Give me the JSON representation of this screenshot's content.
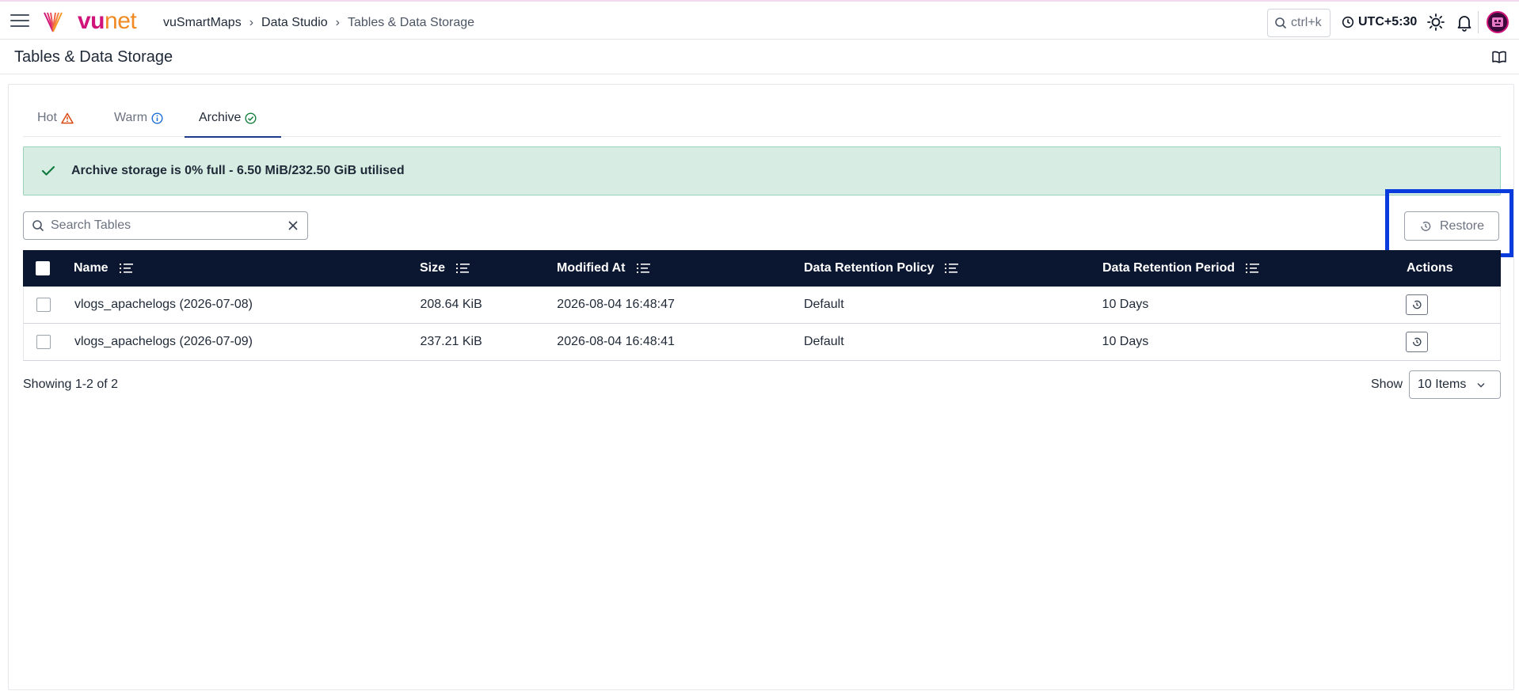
{
  "topbar": {
    "logo_vu": "vu",
    "logo_net": "net",
    "breadcrumb": [
      "vuSmartMaps",
      "Data Studio",
      "Tables & Data Storage"
    ],
    "search_shortcut": "ctrl+k",
    "timezone": "UTC+5:30"
  },
  "page": {
    "title": "Tables & Data Storage"
  },
  "tabs": [
    {
      "label": "Hot",
      "icon": "warning-icon",
      "color": "#d9480f"
    },
    {
      "label": "Warm",
      "icon": "info-icon",
      "color": "#1d6fd8"
    },
    {
      "label": "Archive",
      "icon": "check-circle-icon",
      "color": "#15803d",
      "active": true
    }
  ],
  "alert": {
    "text": "Archive storage is 0% full - 6.50 MiB/232.50 GiB utilised",
    "icon": "check-icon",
    "color": "#0f7a3d"
  },
  "toolbar": {
    "search_placeholder": "Search Tables",
    "restore_label": "Restore"
  },
  "table": {
    "headers": {
      "name": "Name",
      "size": "Size",
      "modified": "Modified At",
      "policy": "Data Retention Policy",
      "period": "Data Retention Period",
      "actions": "Actions"
    },
    "rows": [
      {
        "name": "vlogs_apachelogs (2026-07-08)",
        "size": "208.64 KiB",
        "modified": "2026-08-04 16:48:47",
        "policy": "Default",
        "period": "10 Days"
      },
      {
        "name": "vlogs_apachelogs (2026-07-09)",
        "size": "237.21 KiB",
        "modified": "2026-08-04 16:48:41",
        "policy": "Default",
        "period": "10 Days"
      }
    ]
  },
  "footer": {
    "showing": "Showing 1-2 of 2",
    "show_label": "Show",
    "page_size": "10 Items"
  },
  "colors": {
    "header_bg": "#0b1630",
    "accent": "#d0147a",
    "highlight": "#0a3bdc"
  }
}
